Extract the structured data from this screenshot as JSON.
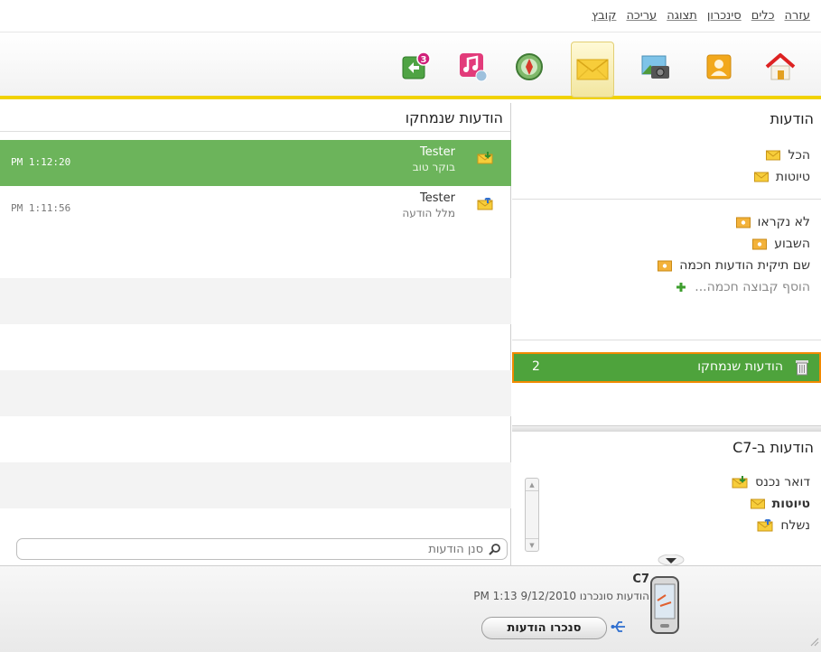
{
  "menu": [
    "קובץ",
    "עריכה",
    "תצוגה",
    "סינכרון",
    "כלים",
    "עזרה"
  ],
  "toolbar": {
    "icons": [
      "home-icon",
      "contacts-icon",
      "photos-icon",
      "messages-icon",
      "maps-icon",
      "music-icon",
      "ovi-store-icon"
    ],
    "active": "messages-icon",
    "badge": "3"
  },
  "list": {
    "title": "הודעות שנמחקו",
    "rows": [
      {
        "sender": "Tester",
        "subject": "בוקר טוב",
        "time": "PM 1:12:20"
      },
      {
        "sender": "Tester",
        "subject": "מלל הודעה",
        "time": "PM 1:11:56"
      }
    ],
    "search_placeholder": "סנן הודעות"
  },
  "folders": {
    "title": "הודעות",
    "all": "הכל",
    "drafts": "טיוטות",
    "unread": "לא נקראו",
    "this_week": "השבוע",
    "smart_folder": "שם תיקית הודעות חכמה",
    "add_smart": "הוסף קבוצה חכמה...",
    "deleted": "הודעות שנמחקו",
    "deleted_count": "2"
  },
  "device_folders": {
    "title": "הודעות ב-C7",
    "inbox": "דואר נכנס",
    "drafts": "טיוטות",
    "sent": "נשלח"
  },
  "device": {
    "name": "C7",
    "status": "הודעות סונכרנו 9/12/2010 PM 1:13",
    "sync_label": "סנכרו הודעות"
  },
  "colors": {
    "accent": "#f1d200",
    "selection": "#6cb45b",
    "highlight_border": "#f18a00"
  }
}
